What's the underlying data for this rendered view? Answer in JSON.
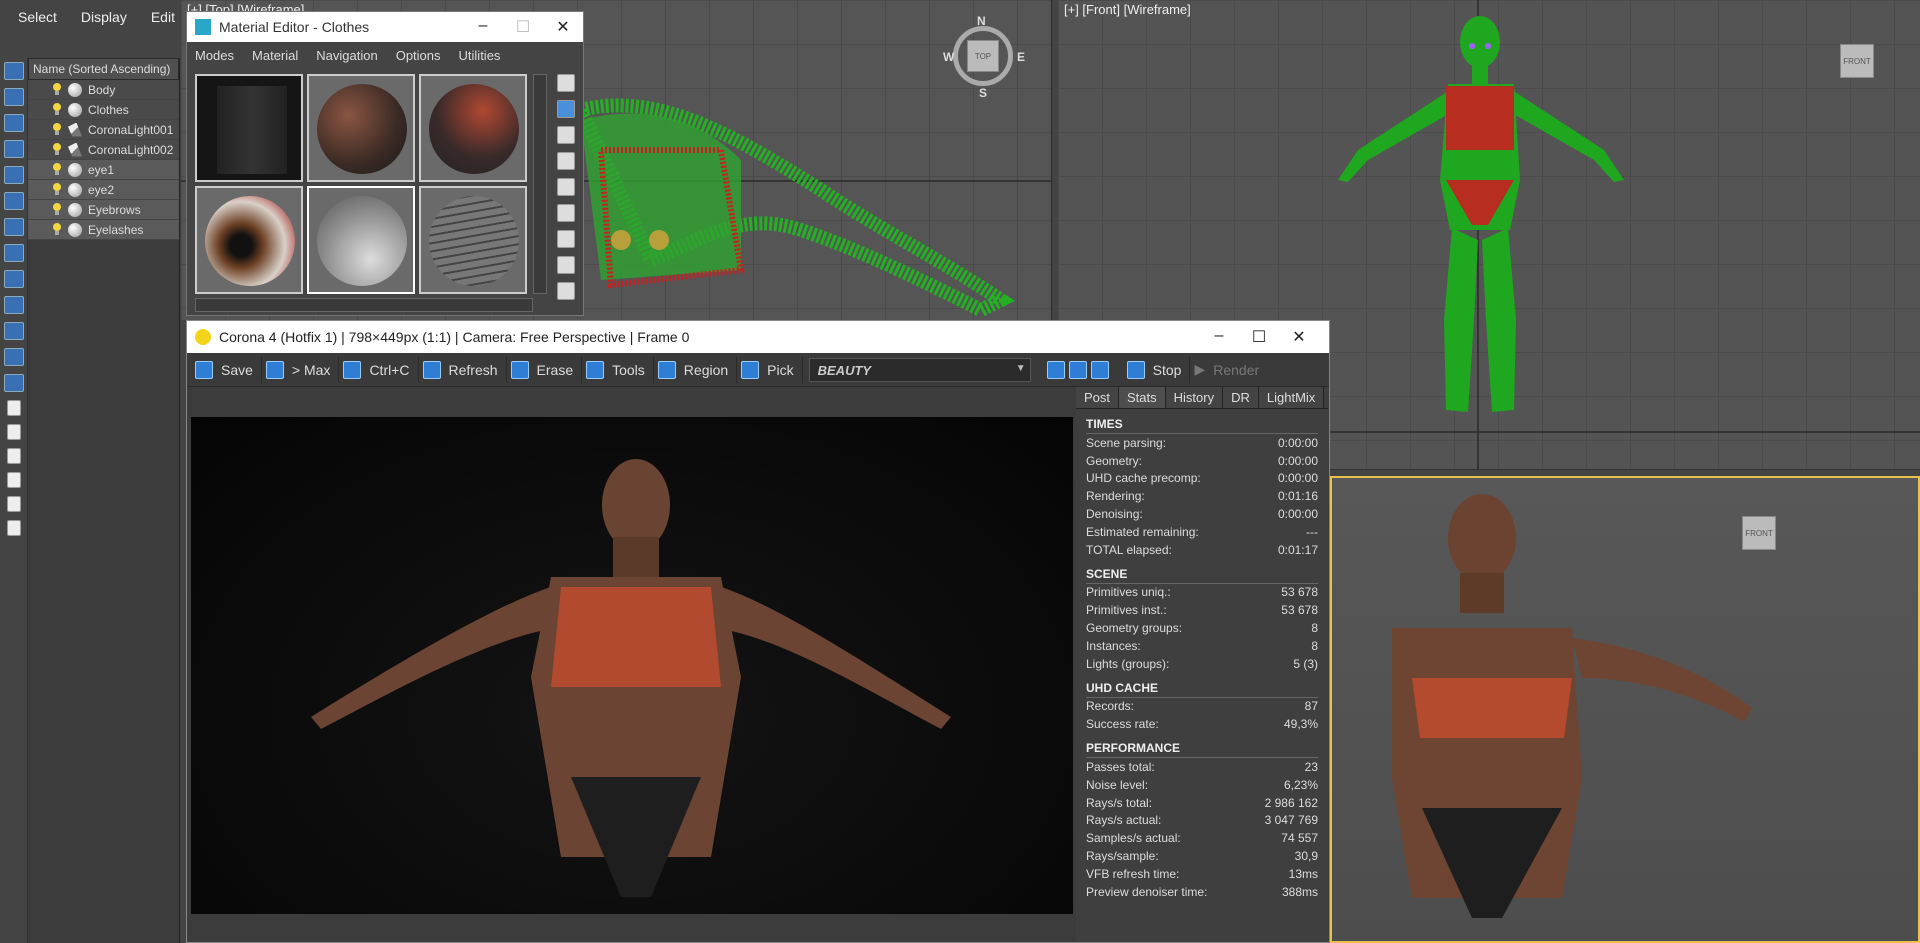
{
  "top_menu": [
    "Select",
    "Display",
    "Edit"
  ],
  "explorer": {
    "header": "Name (Sorted Ascending)",
    "items": [
      {
        "label": "Body",
        "icon": "sphere"
      },
      {
        "label": "Clothes",
        "icon": "sphere"
      },
      {
        "label": "CoronaLight001",
        "icon": "light"
      },
      {
        "label": "CoronaLight002",
        "icon": "light"
      },
      {
        "label": "eye1",
        "icon": "sphere"
      },
      {
        "label": "eye2",
        "icon": "sphere"
      },
      {
        "label": "Eyebrows",
        "icon": "sphere"
      },
      {
        "label": "Eyelashes",
        "icon": "sphere"
      }
    ]
  },
  "viewports": {
    "top_label": "[+] [Top] [Wireframe]",
    "front_label": "[+] [Front] [Wireframe]",
    "front_cube": "FRONT",
    "top_cube": "TOP",
    "compass": {
      "n": "N",
      "e": "E",
      "s": "S",
      "w": "W"
    }
  },
  "material_editor": {
    "title": "Material Editor - Clothes",
    "menu": [
      "Modes",
      "Material",
      "Navigation",
      "Options",
      "Utilities"
    ]
  },
  "vfb": {
    "title": "Corona 4 (Hotfix 1) | 798×449px (1:1) | Camera: Free Perspective | Frame 0",
    "toolbar": {
      "save": "Save",
      "to_max": "> Max",
      "copy": "Ctrl+C",
      "refresh": "Refresh",
      "erase": "Erase",
      "tools": "Tools",
      "region": "Region",
      "pick": "Pick",
      "pass": "BEAUTY",
      "stop": "Stop",
      "render": "Render"
    },
    "tabs": [
      "Post",
      "Stats",
      "History",
      "DR",
      "LightMix"
    ],
    "sections": [
      {
        "title": "TIMES",
        "rows": [
          [
            "Scene parsing:",
            "0:00:00"
          ],
          [
            "Geometry:",
            "0:00:00"
          ],
          [
            "UHD cache precomp:",
            "0:00:00"
          ],
          [
            "Rendering:",
            "0:01:16"
          ],
          [
            "Denoising:",
            "0:00:00"
          ],
          [
            "Estimated remaining:",
            "---"
          ],
          [
            "TOTAL elapsed:",
            "0:01:17"
          ]
        ]
      },
      {
        "title": "SCENE",
        "rows": [
          [
            "Primitives uniq.:",
            "53 678"
          ],
          [
            "Primitives inst.:",
            "53 678"
          ],
          [
            "Geometry groups:",
            "8"
          ],
          [
            "Instances:",
            "8"
          ],
          [
            "Lights (groups):",
            "5 (3)"
          ]
        ]
      },
      {
        "title": "UHD CACHE",
        "rows": [
          [
            "Records:",
            "87"
          ],
          [
            "Success rate:",
            "49,3%"
          ]
        ]
      },
      {
        "title": "PERFORMANCE",
        "rows": [
          [
            "Passes total:",
            "23"
          ],
          [
            "Noise level:",
            "6,23%"
          ],
          [
            "Rays/s total:",
            "2 986 162"
          ],
          [
            "Rays/s actual:",
            "3 047 769"
          ],
          [
            "Samples/s actual:",
            "74 557"
          ],
          [
            "Rays/sample:",
            "30,9"
          ],
          [
            "VFB refresh time:",
            "13ms"
          ],
          [
            "Preview denoiser time:",
            "388ms"
          ]
        ]
      }
    ]
  },
  "colors": {
    "accent": "#2e7ed6",
    "wire_green": "#1fa71f",
    "wire_red": "#c82020",
    "viewport_active": "#e8c24a"
  }
}
